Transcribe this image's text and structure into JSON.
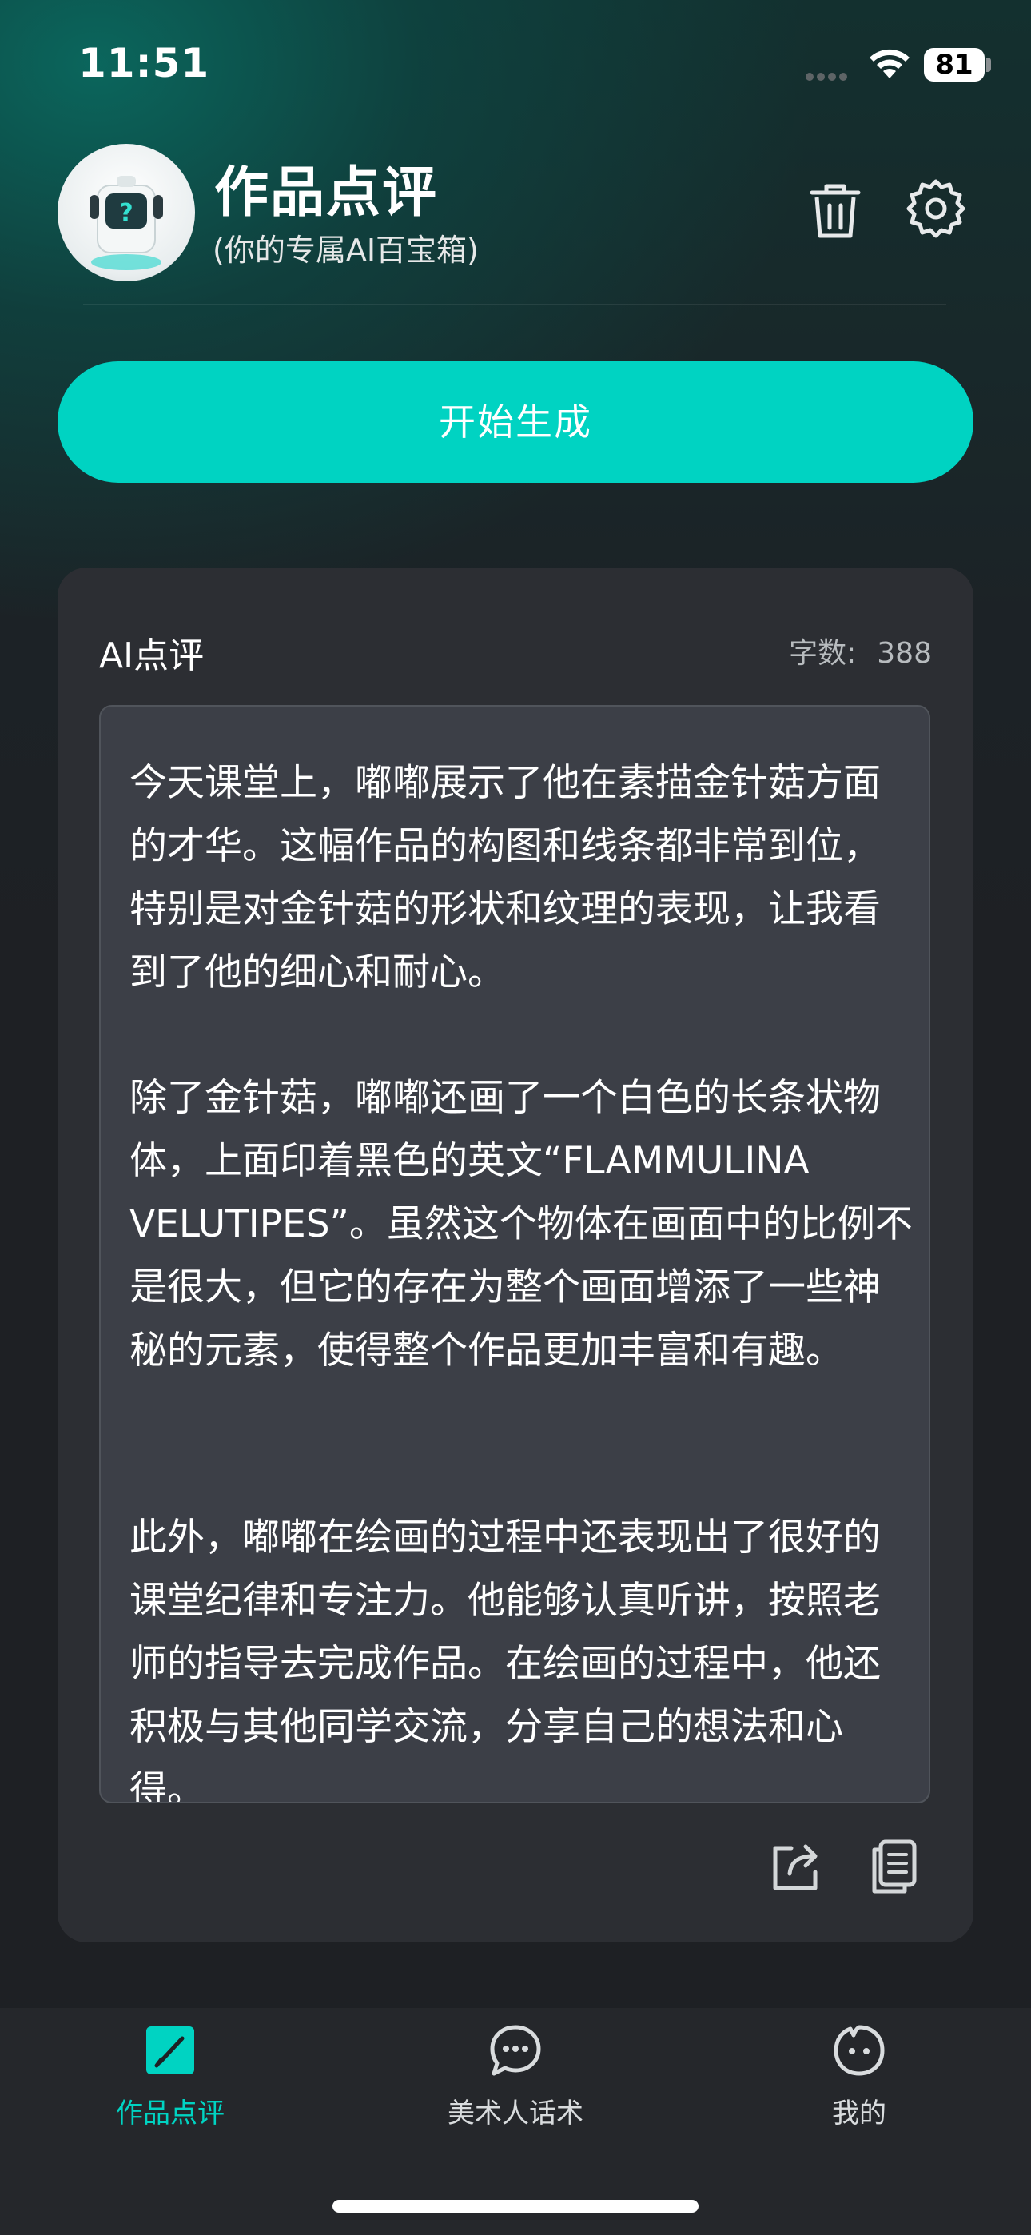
{
  "status_bar": {
    "time": "11:51",
    "battery": "81"
  },
  "header": {
    "title": "作品点评",
    "subtitle": "(你的专属AI百宝箱)",
    "trash_icon": "trash-icon",
    "settings_icon": "gear-icon"
  },
  "start_button": {
    "label": "开始生成"
  },
  "card": {
    "title": "AI点评",
    "count_label": "字数:",
    "count_value": "388",
    "paragraphs": [
      "今天课堂上，嘟嘟展示了他在素描金针菇方面的才华。这幅作品的构图和线条都非常到位，特别是对金针菇的形状和纹理的表现，让我看到了他的细心和耐心。",
      "除了金针菇，嘟嘟还画了一个白色的长条状物体，上面印着黑色的英文“FLAMMULINA VELUTIPES”。虽然这个物体在画面中的比例不是很大，但它的存在为整个画面增添了一些神秘的元素，使得整个作品更加丰富和有趣。",
      "此外，嘟嘟在绘画的过程中还表现出了很好的课堂纪律和专注力。他能够认真听讲，按照老师的指导去完成作品。在绘画的过程中，他还积极与其他同学交流，分享自己的想法和心得。"
    ],
    "share_icon": "share-icon",
    "copy_icon": "copy-icon"
  },
  "tabs": [
    {
      "label": "作品点评",
      "icon": "edit-square-icon",
      "active": true
    },
    {
      "label": "美术人话术",
      "icon": "chat-bubble-icon",
      "active": false
    },
    {
      "label": "我的",
      "icon": "face-icon",
      "active": false
    }
  ],
  "colors": {
    "accent": "#00d3c2",
    "background": "#1e2024",
    "card": "#2c2e33",
    "textbox": "#3c3f47"
  }
}
